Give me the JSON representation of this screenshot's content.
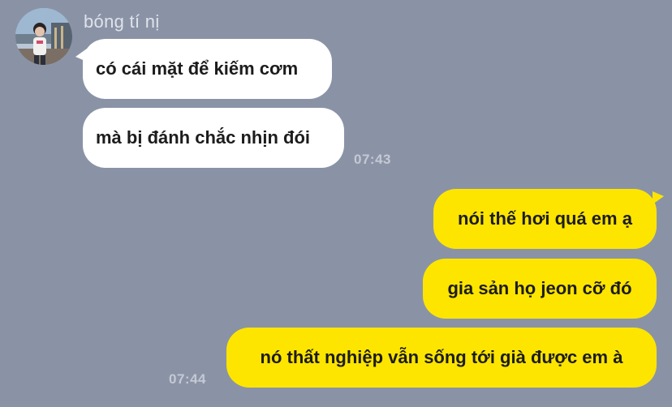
{
  "chat": {
    "sender_name": "bóng tí nị",
    "avatar_icon": "profile-photo",
    "messages": [
      {
        "direction": "incoming",
        "text": "có cái mặt để kiếm cơm"
      },
      {
        "direction": "incoming",
        "text": "mà bị đánh chắc nhịn đói",
        "time": "07:43"
      },
      {
        "direction": "outgoing",
        "text": "nói thế hơi quá em ạ"
      },
      {
        "direction": "outgoing",
        "text": "gia sản họ jeon cỡ đó"
      },
      {
        "direction": "outgoing",
        "text": "nó thất nghiệp vẫn sống tới già được em à",
        "time": "07:44"
      }
    ]
  },
  "colors": {
    "background": "#8a93a6",
    "incoming_bubble": "#ffffff",
    "outgoing_bubble": "#fee500",
    "timestamp": "#c4c9d3"
  }
}
